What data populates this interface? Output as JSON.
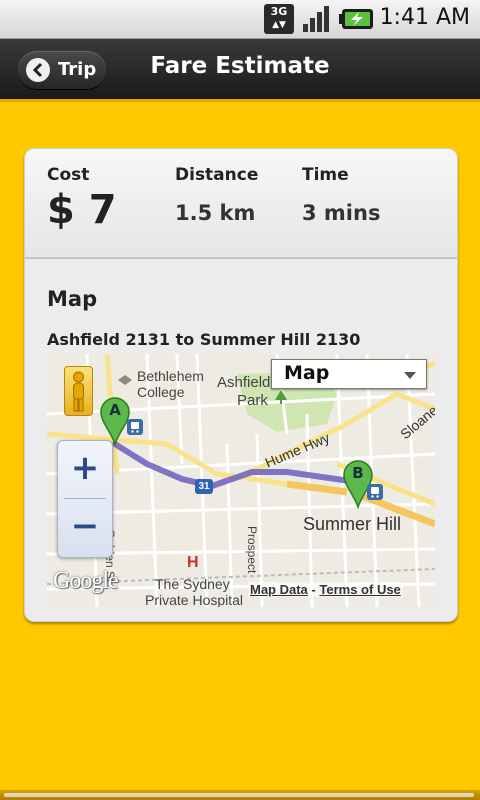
{
  "status_bar": {
    "network": "3G",
    "time": "1:41 AM"
  },
  "titlebar": {
    "back_label": "Trip",
    "title": "Fare Estimate"
  },
  "stats": {
    "cost_label": "Cost",
    "cost_value": "$ 7",
    "distance_label": "Distance",
    "distance_value": "1.5 km",
    "time_label": "Time",
    "time_value": "3 mins"
  },
  "map_section": {
    "title": "Map",
    "route": "Ashfield 2131 to Summer Hill 2130",
    "map_type_selected": "Map",
    "zoom_in": "+",
    "zoom_out": "−",
    "marker_a": "A",
    "marker_b": "B",
    "labels": {
      "bethlehem": "Bethlehem",
      "college": "College",
      "ashfield": "Ashfield",
      "park": "Park",
      "hume_hwy": "Hume Hwy",
      "sloane": "Sloane",
      "route_31": "31",
      "summer_hill": "Summer Hill",
      "golden_st": "Golden St",
      "prospect": "Prospect",
      "hospital_h": "H",
      "sydney": "The Sydney",
      "private_hospital": "Private Hospital"
    },
    "google": "Google",
    "map_data": "Map Data",
    "separator": "-",
    "terms": "Terms of Use"
  }
}
